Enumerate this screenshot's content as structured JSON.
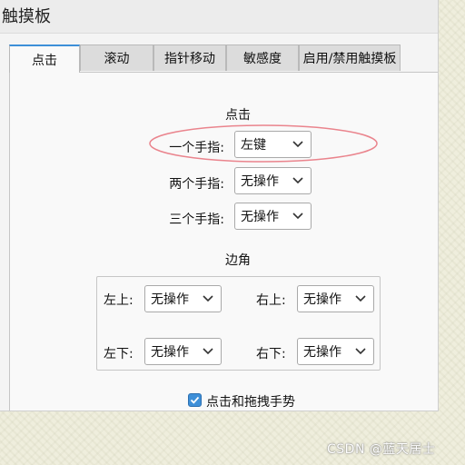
{
  "window": {
    "title": "触摸板"
  },
  "tabs": [
    {
      "label": "点击",
      "active": true
    },
    {
      "label": "滚动",
      "active": false
    },
    {
      "label": "指针移动",
      "active": false
    },
    {
      "label": "敏感度",
      "active": false
    },
    {
      "label": "启用/禁用触摸板",
      "active": false
    }
  ],
  "click_section": {
    "title": "点击",
    "rows": [
      {
        "label": "一个手指:",
        "value": "左键"
      },
      {
        "label": "两个手指:",
        "value": "无操作"
      },
      {
        "label": "三个手指:",
        "value": "无操作"
      }
    ]
  },
  "corner_section": {
    "title": "边角",
    "top_left": {
      "label": "左上:",
      "value": "无操作"
    },
    "top_right": {
      "label": "右上:",
      "value": "无操作"
    },
    "bottom_left": {
      "label": "左下:",
      "value": "无操作"
    },
    "bottom_right": {
      "label": "右下:",
      "value": "无操作"
    }
  },
  "drag_checkbox": {
    "label": "点击和拖拽手势",
    "checked": true
  },
  "watermark": "CSDN @蓝天居士",
  "colors": {
    "accent": "#3d8fd8",
    "annotation": "#e8707a"
  },
  "icons": {
    "dropdown": "chevron-down-icon",
    "checkbox": "checkmark-icon"
  }
}
